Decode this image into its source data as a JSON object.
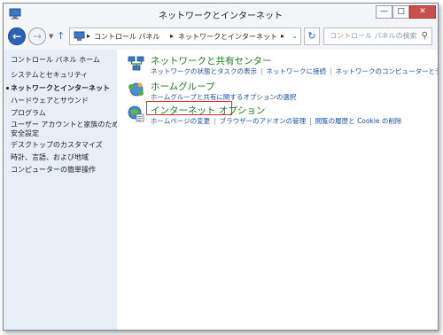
{
  "window": {
    "title": "ネットワークとインターネット",
    "minimize_label": "—",
    "maximize_label": "□",
    "close_label": "✕"
  },
  "addressbar": {
    "crumbs": [
      "コントロール パネル",
      "ネットワークとインターネット"
    ],
    "separator": "▸",
    "search_placeholder": "コントロール パネルの検索"
  },
  "sidebar": {
    "home": "コントロール パネル ホーム",
    "items": [
      "システムとセキュリティ",
      "ネットワークとインターネット",
      "ハードウェアとサウンド",
      "プログラム",
      "ユーザー アカウントと家族のための",
      "安全設定",
      "デスクトップのカスタマイズ",
      "時計、言語、および地域",
      "コンピューターの簡単操作"
    ]
  },
  "categories": [
    {
      "title": "ネットワークと共有センター",
      "links": [
        "ネットワークの状態とタスクの表示",
        "ネットワークに接続",
        "ネットワークのコンピューターとデバイスの表示"
      ]
    },
    {
      "title": "ホームグループ",
      "links": [
        "ホームグループと共有に関するオプションの選択"
      ]
    },
    {
      "title": "インターネット オプション",
      "links": [
        "ホームページの変更",
        "ブラウザーのアドオンの管理",
        "閲覧の履歴と Cookie の削除"
      ]
    }
  ],
  "colors": {
    "category_title": "#1e7b1e",
    "link": "#1f4fa0",
    "highlight_border": "#d62c2c",
    "sidebar_bg": "#e6eef8"
  }
}
